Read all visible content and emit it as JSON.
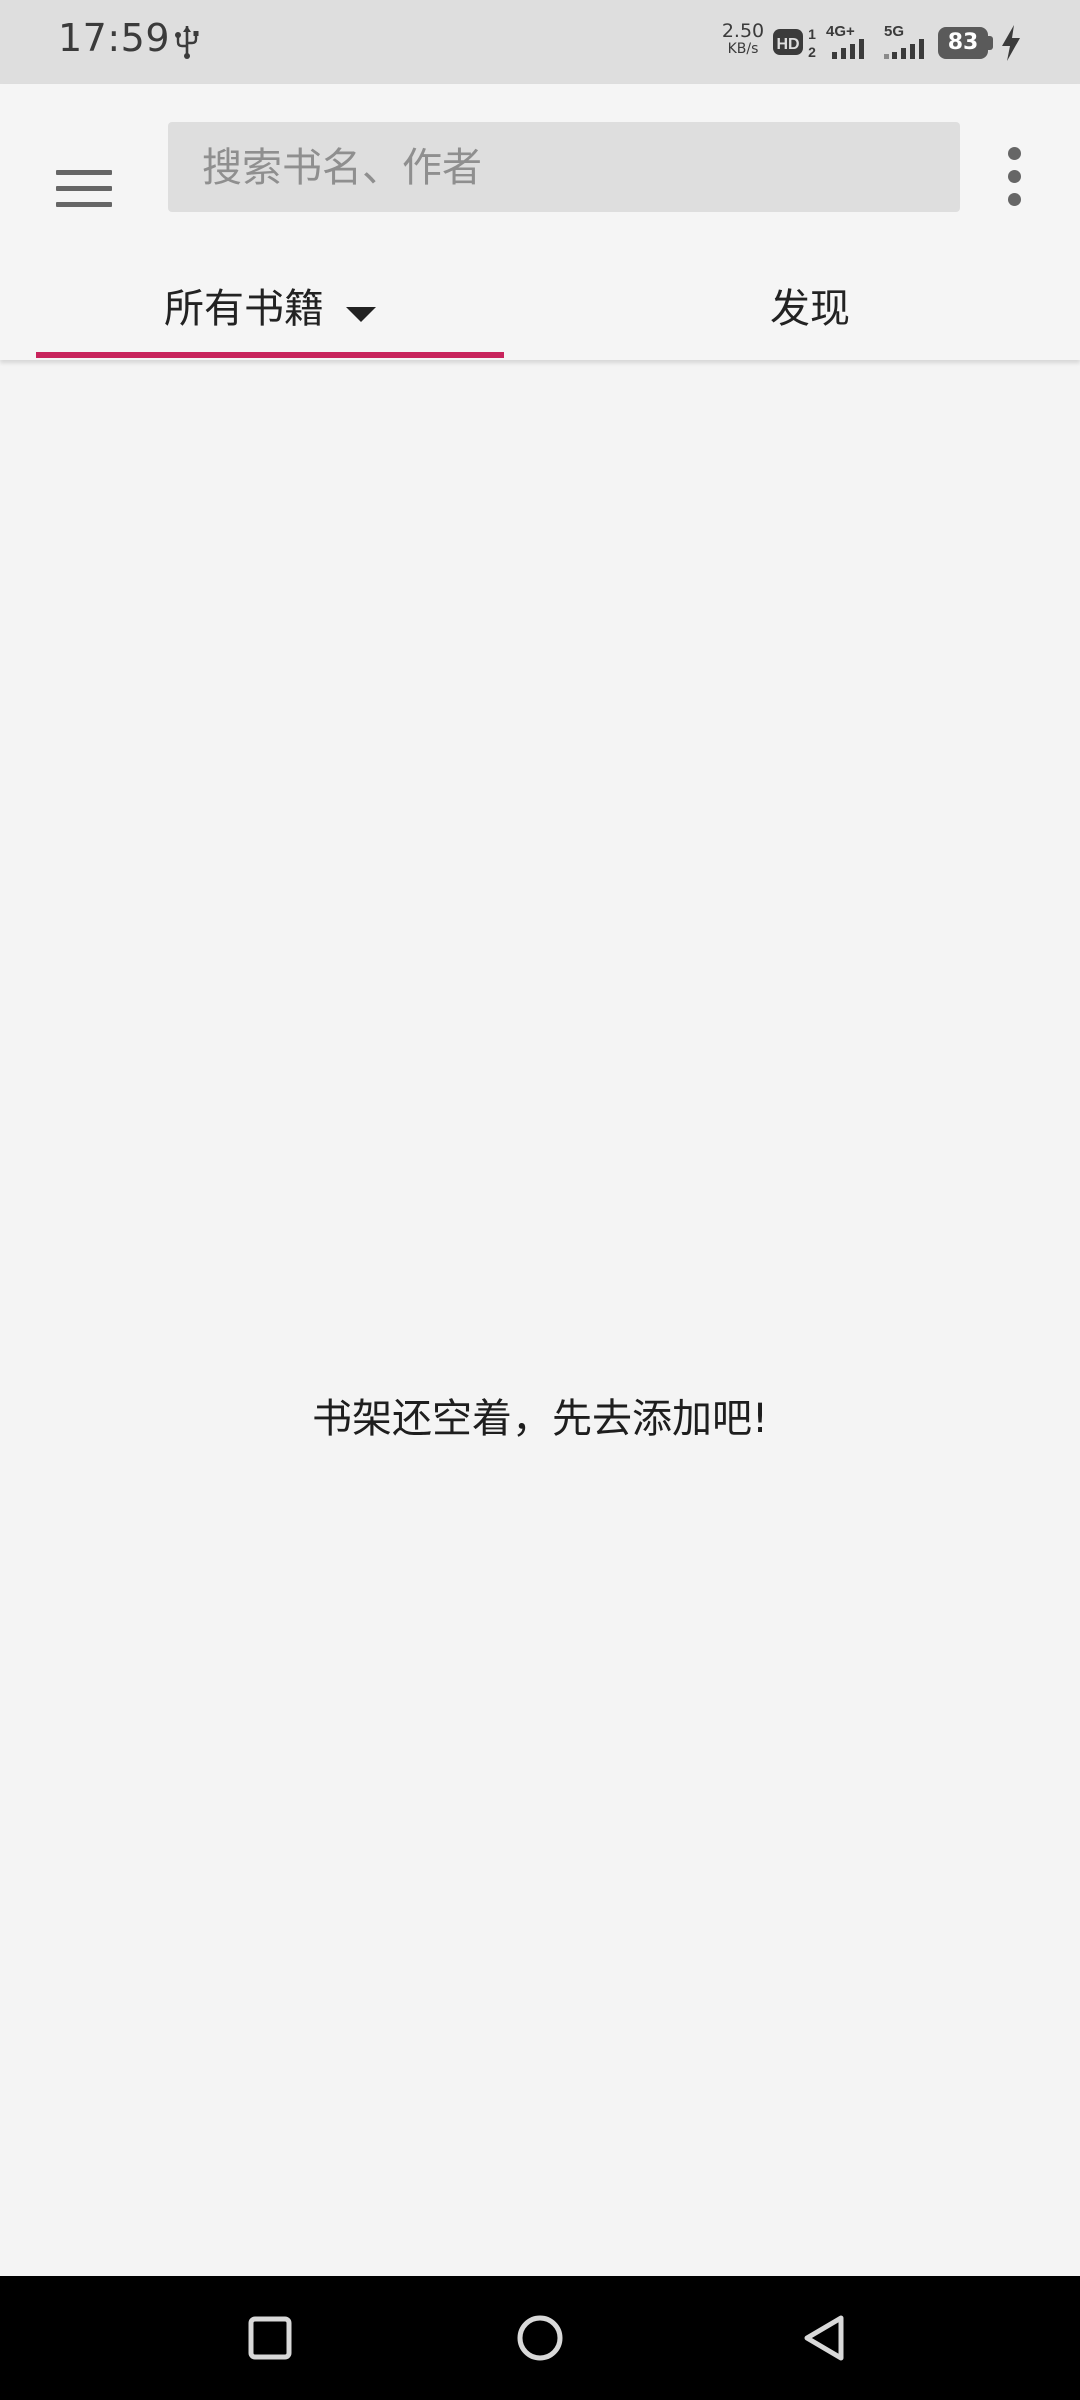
{
  "status_bar": {
    "time": "17:59",
    "net_speed_value": "2.50",
    "net_speed_unit": "KB/s",
    "hd_label": "HD",
    "hd_sim_top": "1",
    "hd_sim_bottom": "2",
    "sim1_label": "4G+",
    "sim2_label": "5G",
    "battery_percent": "83",
    "icons": [
      "usb-icon",
      "hd-voice-icon",
      "signal-4g-icon",
      "signal-5g-icon",
      "battery-icon",
      "charging-bolt-icon"
    ]
  },
  "app_bar": {
    "search_placeholder": "搜索书名、作者",
    "tabs": [
      {
        "label": "所有书籍",
        "selected": true
      },
      {
        "label": "发现",
        "selected": false
      }
    ],
    "accent_color": "#c8245c"
  },
  "main": {
    "empty_message": "书架还空着，先去添加吧!"
  },
  "nav_bar": {
    "buttons": [
      "recents-icon",
      "home-icon",
      "back-icon"
    ]
  }
}
